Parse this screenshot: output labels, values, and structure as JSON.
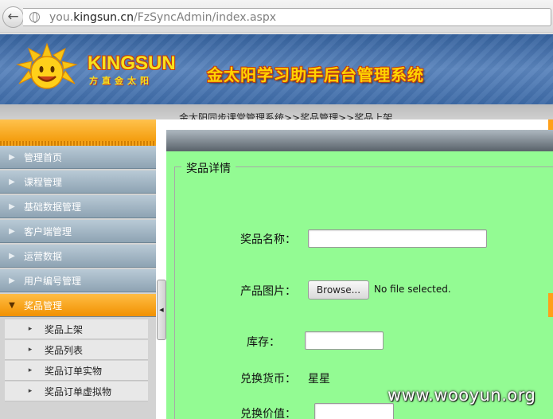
{
  "browser": {
    "url_prefix": "you.",
    "url_domain": "kingsun.cn",
    "url_path": "/FzSyncAdmin/index.aspx"
  },
  "banner": {
    "brand_name": "KINGSUN",
    "brand_subtitle": "方直金太阳",
    "system_title": "金太阳学习助手后台管理系统"
  },
  "breadcrumb": "金太阳同步课堂管理系统>>奖品管理>>奖品上架",
  "sidebar": {
    "items": [
      {
        "label": "管理首页",
        "active": false
      },
      {
        "label": "课程管理",
        "active": false
      },
      {
        "label": "基础数据管理",
        "active": false
      },
      {
        "label": "客户端管理",
        "active": false
      },
      {
        "label": "运营数据",
        "active": false
      },
      {
        "label": "用户编号管理",
        "active": false
      },
      {
        "label": "奖品管理",
        "active": true
      }
    ],
    "sub_items": [
      {
        "label": "奖品上架"
      },
      {
        "label": "奖品列表"
      },
      {
        "label": "奖品订单实物"
      },
      {
        "label": "奖品订单虚拟物"
      }
    ]
  },
  "form": {
    "legend": "奖品详情",
    "name_label": "奖品名称：",
    "name_value": "",
    "image_label": "产品图片：",
    "browse_label": "Browse...",
    "file_status": "No file selected.",
    "stock_label": "库存：",
    "stock_value": "",
    "currency_label": "兑换货币：",
    "currency_value": "星星",
    "value_label": "兑换价值：",
    "value_value": ""
  },
  "watermark": "www.wooyun.org",
  "colors": {
    "content_bg": "#93fb93",
    "menu_active": "#f19100",
    "banner_blue": "#3d6aa6",
    "title_yellow": "#ffd400"
  }
}
